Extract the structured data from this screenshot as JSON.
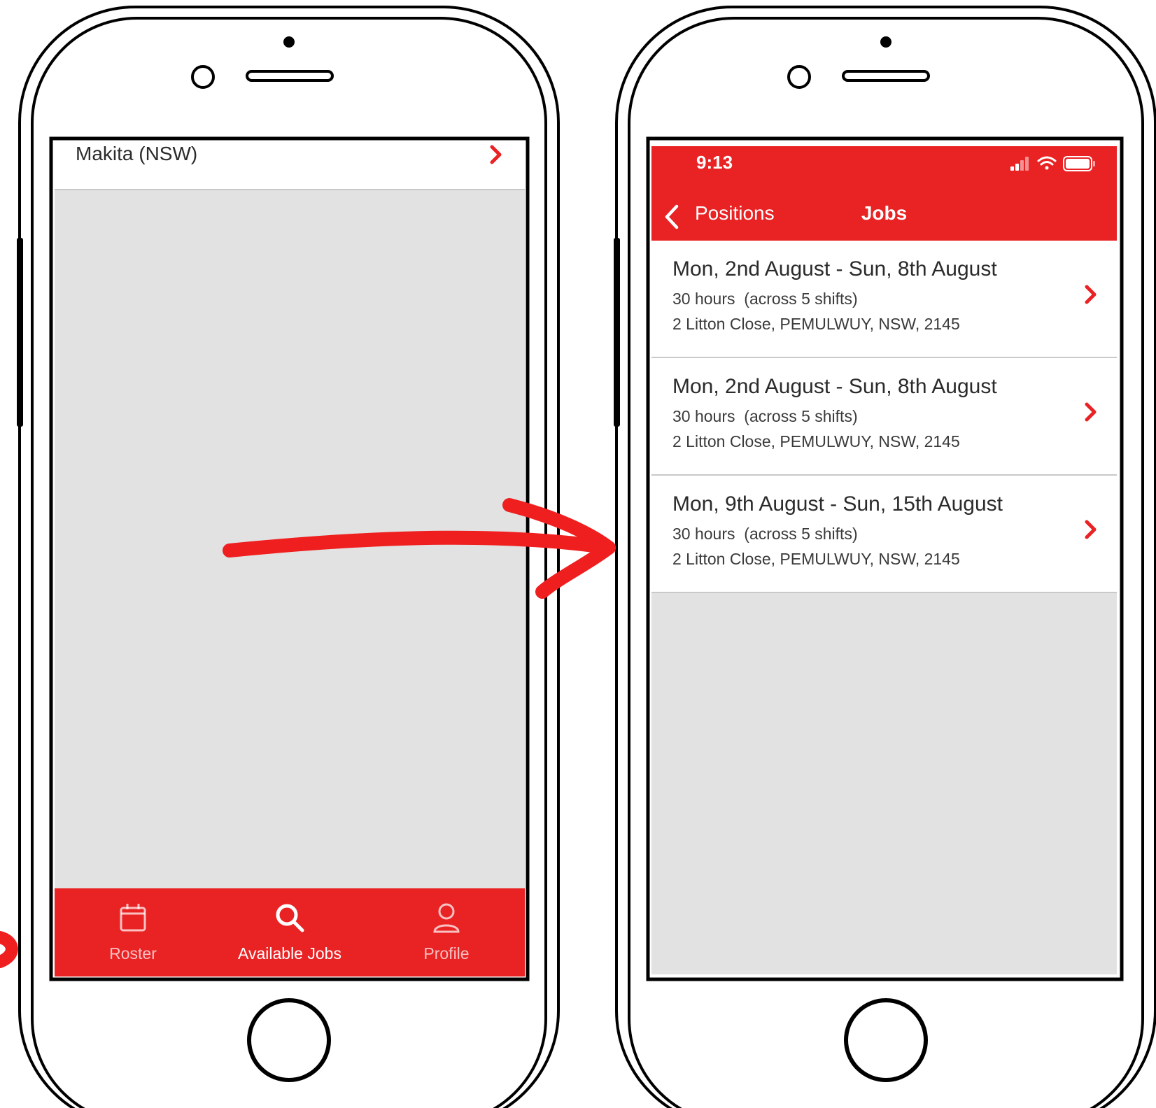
{
  "colors": {
    "brand": "#e92224",
    "background": "#e2e2e2",
    "text": "#2b2b2b"
  },
  "left_phone": {
    "row": {
      "label": "Makita (NSW)",
      "icon": "chevron-right-icon"
    },
    "tabbar": {
      "tabs": [
        {
          "label": "Roster",
          "icon": "calendar-icon",
          "active": false
        },
        {
          "label": "Available Jobs",
          "icon": "search-icon",
          "active": true
        },
        {
          "label": "Profile",
          "icon": "person-icon",
          "active": false
        }
      ]
    }
  },
  "right_phone": {
    "status": {
      "time": "9:13",
      "icons": [
        "signal-icon",
        "wifi-icon",
        "battery-icon"
      ]
    },
    "navbar": {
      "back_label": "Positions",
      "title": "Jobs"
    },
    "jobs": [
      {
        "dates": "Mon, 2nd August - Sun, 8th August",
        "hours": "30 hours  (across 5 shifts)",
        "address": "2 Litton Close, PEMULWUY, NSW, 2145"
      },
      {
        "dates": "Mon, 2nd August - Sun, 8th August",
        "hours": "30 hours  (across 5 shifts)",
        "address": "2 Litton Close, PEMULWUY, NSW, 2145"
      },
      {
        "dates": "Mon, 9th August - Sun, 15th August",
        "hours": "30 hours  (across 5 shifts)",
        "address": "2 Litton Close, PEMULWUY, NSW, 2145"
      }
    ]
  }
}
